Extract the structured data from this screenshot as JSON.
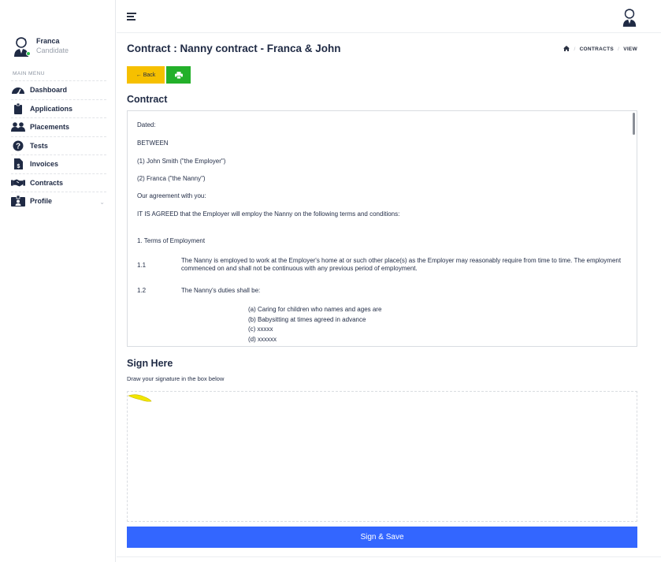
{
  "user": {
    "name": "Franca",
    "role": "Candidate"
  },
  "sidebar": {
    "menu_title": "MAIN MENU",
    "items": [
      {
        "label": "Dashboard",
        "icon": "dashboard-icon"
      },
      {
        "label": "Applications",
        "icon": "clipboard-icon"
      },
      {
        "label": "Placements",
        "icon": "users-icon"
      },
      {
        "label": "Tests",
        "icon": "question-icon"
      },
      {
        "label": "Invoices",
        "icon": "invoice-icon"
      },
      {
        "label": "Contracts",
        "icon": "handshake-icon"
      },
      {
        "label": "Profile",
        "icon": "id-card-icon"
      }
    ]
  },
  "header": {
    "title": "Contract : Nanny contract - Franca & John",
    "breadcrumb": [
      "CONTRACTS",
      "VIEW"
    ]
  },
  "toolbar": {
    "back_label": "Back"
  },
  "contract": {
    "heading": "Contract",
    "dated": "Dated:",
    "between": "BETWEEN",
    "party1": "(1) John Smith  (\"the Employer\")",
    "party2": "(2) Franca (\"the Nanny\")",
    "agreement": "Our agreement with you:",
    "agreed": "IT IS AGREED that the Employer will employ the Nanny on the following terms and conditions:",
    "section1": "1. Terms of Employment",
    "c11_num": "1.1",
    "c11_text": "The Nanny is employed to work at the Employer's home at or such other place(s) as the Employer may reasonably require from time to time. The employment commenced on and shall not be continuous with any previous period of employment.",
    "c12_num": "1.2",
    "c12_text": "The Nanny's duties shall be:",
    "duties": [
      "(a) Caring for children who names and ages are",
      "(b) Babysitting at times agreed in advance",
      "(c) xxxxx",
      "(d) xxxxxx"
    ]
  },
  "sign": {
    "heading": "Sign Here",
    "instruction": "Draw your signature in the box below",
    "save_label": "Sign & Save"
  },
  "colors": {
    "back_button": "#f6c000",
    "print_button": "#23b02a",
    "save_button": "#3366ff",
    "signature_ink": "#f2e600"
  }
}
